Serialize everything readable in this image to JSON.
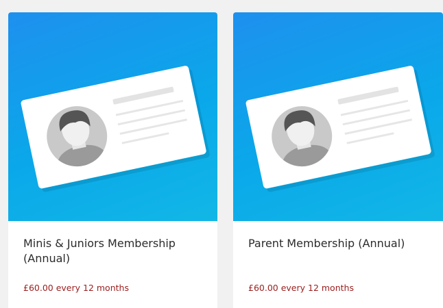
{
  "products": [
    {
      "title": "Minis & Juniors Membership (Annual)",
      "price": "£60.00 every 12 months"
    },
    {
      "title": "Parent Membership (Annual)",
      "price": "£60.00 every 12 months"
    }
  ],
  "colors": {
    "page_background": "#f1f1f1",
    "image_gradient_start": "#1e90ee",
    "image_gradient_end": "#12b7e6",
    "price_text": "#9b1c1c",
    "title_text": "#2b2b2b"
  },
  "icons": [
    "membership-card-illustration",
    "person-avatar-icon"
  ]
}
